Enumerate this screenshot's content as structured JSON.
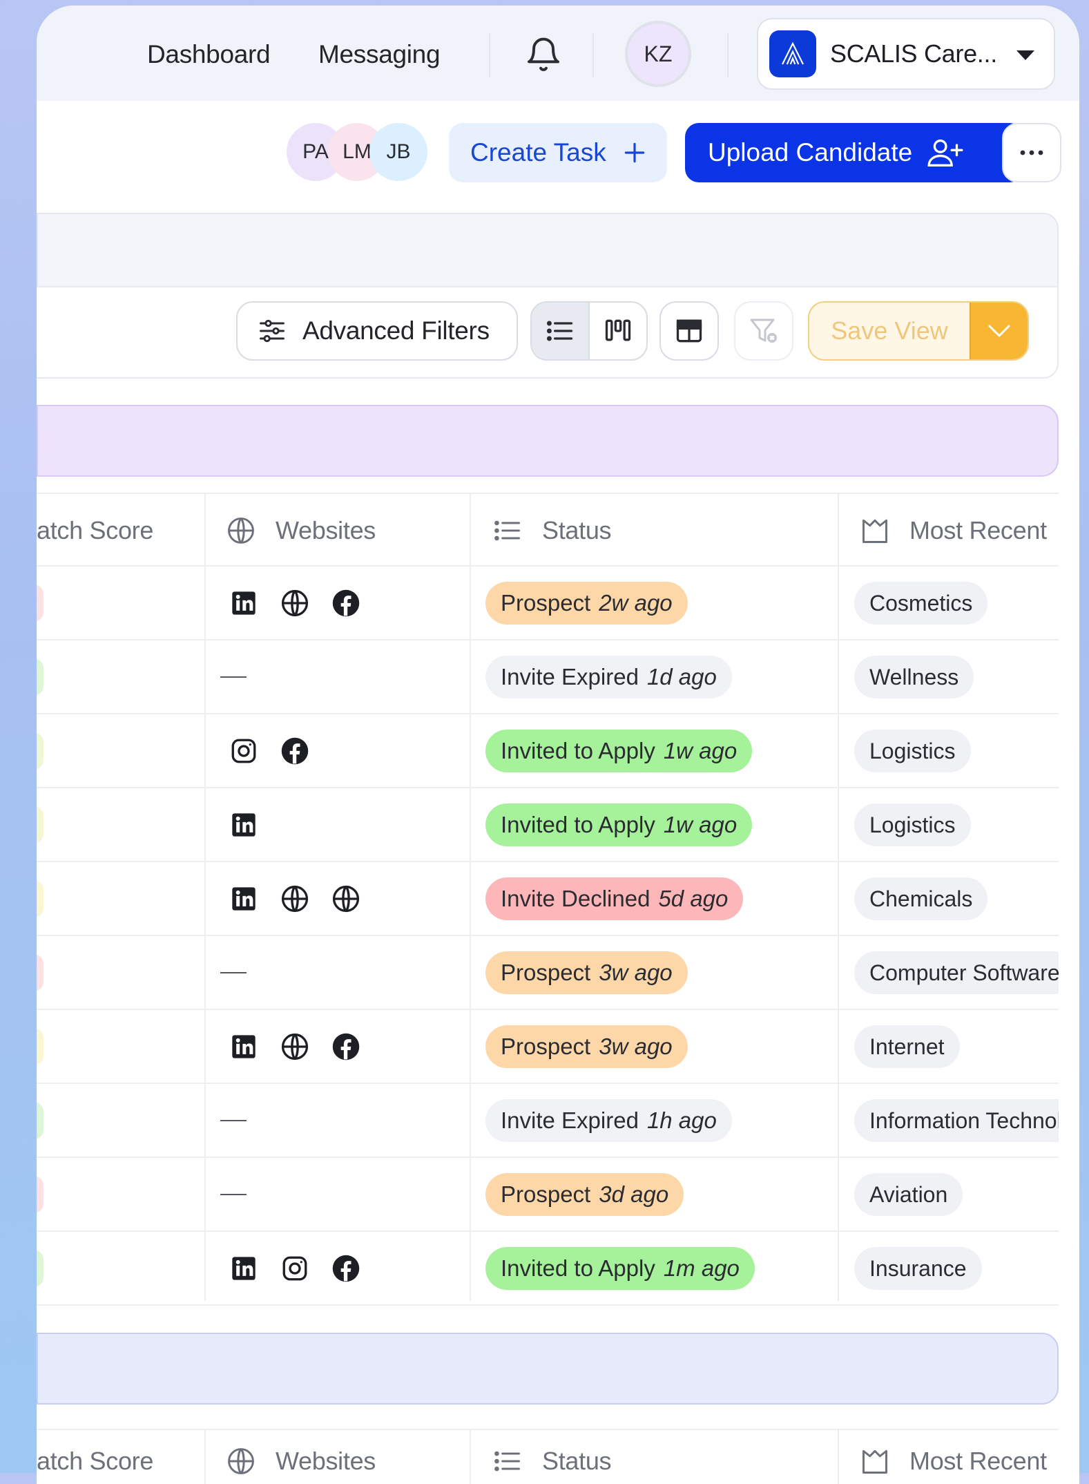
{
  "nav": {
    "links": [
      "Dashboard",
      "Messaging"
    ],
    "user_initials": "KZ",
    "company_name": "SCALIS Care..."
  },
  "actions": {
    "collaborators": [
      {
        "initials": "PA",
        "color": "#ece3fb"
      },
      {
        "initials": "LM",
        "color": "#fbe3ee"
      },
      {
        "initials": "JB",
        "color": "#dcefff"
      }
    ],
    "create_task": "Create Task",
    "upload_candidate": "Upload Candidate"
  },
  "toolbar": {
    "advanced_filters": "Advanced Filters",
    "save_view": "Save View"
  },
  "table": {
    "headers": {
      "match_score": "atch Score",
      "websites": "Websites",
      "status": "Status",
      "most_recent": "Most Recent"
    },
    "rows": [
      {
        "score_color": "#fde2e4",
        "websites": [
          "linkedin-icon",
          "globe-icon",
          "facebook-icon"
        ],
        "status": "Prospect",
        "ago": "2w ago",
        "status_color": "#fdd7a8",
        "industry": "Cosmetics"
      },
      {
        "score_color": "#dff6d6",
        "websites": [],
        "status": "Invite Expired",
        "ago": "1d ago",
        "status_color": "#f0f2f5",
        "industry": "Wellness"
      },
      {
        "score_color": "#eef8d4",
        "websites": [
          "instagram-icon",
          "facebook-icon"
        ],
        "status": "Invited to Apply",
        "ago": "1w ago",
        "status_color": "#a6f29a",
        "industry": "Logistics"
      },
      {
        "score_color": "#f3f7d2",
        "websites": [
          "linkedin-icon"
        ],
        "status": "Invited to Apply",
        "ago": "1w ago",
        "status_color": "#a6f29a",
        "industry": "Logistics"
      },
      {
        "score_color": "#fbf5d2",
        "websites": [
          "linkedin-icon",
          "globe-icon",
          "globe-icon"
        ],
        "status": "Invite Declined",
        "ago": "5d ago",
        "status_color": "#fdb7b9",
        "industry": "Chemicals"
      },
      {
        "score_color": "#fde2e4",
        "websites": [],
        "status": "Prospect",
        "ago": "3w ago",
        "status_color": "#fdd7a8",
        "industry": "Computer Software"
      },
      {
        "score_color": "#fbf5d2",
        "websites": [
          "linkedin-icon",
          "globe-icon",
          "facebook-icon"
        ],
        "status": "Prospect",
        "ago": "3w ago",
        "status_color": "#fdd7a8",
        "industry": "Internet"
      },
      {
        "score_color": "#dff6d6",
        "websites": [],
        "status": "Invite Expired",
        "ago": "1h ago",
        "status_color": "#f0f2f5",
        "industry": "Information Technology"
      },
      {
        "score_color": "#fde2e4",
        "websites": [],
        "status": "Prospect",
        "ago": "3d ago",
        "status_color": "#fdd7a8",
        "industry": "Aviation"
      },
      {
        "score_color": "#dff6d6",
        "websites": [
          "linkedin-icon",
          "instagram-icon",
          "facebook-icon"
        ],
        "status": "Invited to Apply",
        "ago": "1m ago",
        "status_color": "#a6f29a",
        "industry": "Insurance"
      }
    ]
  },
  "colors": {
    "primary": "#0b34e6",
    "create_task_bg": "#e8f0fd",
    "save_view_accent": "#f7b733"
  }
}
